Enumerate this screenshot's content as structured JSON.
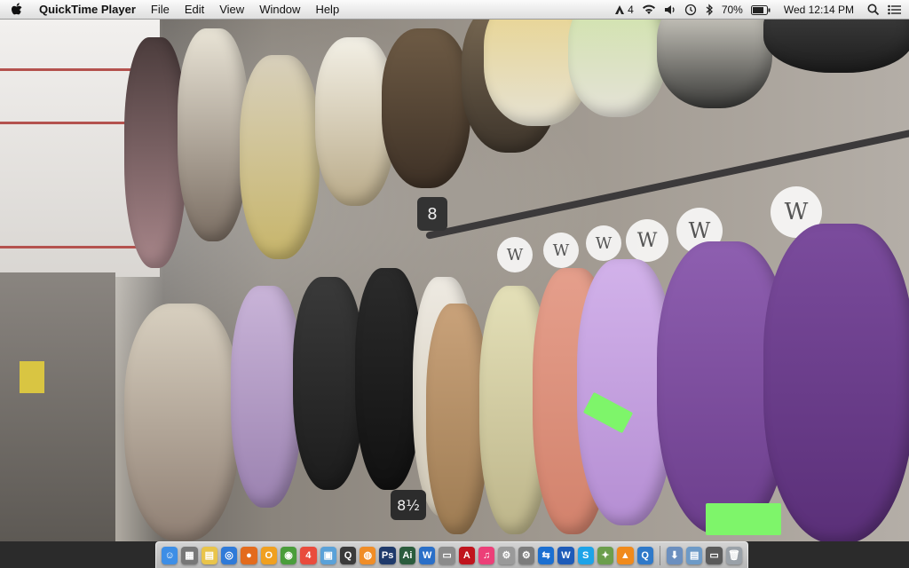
{
  "menubar": {
    "app_name": "QuickTime Player",
    "menus": [
      "File",
      "Edit",
      "View",
      "Window",
      "Help"
    ],
    "status": {
      "adobe_count": "4",
      "battery": "70%",
      "clock": "Wed 12:14 PM"
    }
  },
  "video": {
    "tags": [
      "W",
      "W",
      "W",
      "W",
      "W",
      "W",
      "W"
    ],
    "size_tags": [
      "8",
      "8½"
    ]
  },
  "dock": {
    "icons": [
      {
        "name": "finder-icon",
        "color": "#3d8ee6",
        "glyph": "☺"
      },
      {
        "name": "calculator-icon",
        "color": "#777777",
        "glyph": "▦"
      },
      {
        "name": "folder-icon",
        "color": "#e9c44a",
        "glyph": "▤"
      },
      {
        "name": "safari-icon",
        "color": "#2f7ad8",
        "glyph": "◎"
      },
      {
        "name": "firefox-icon",
        "color": "#e36b1c",
        "glyph": "●"
      },
      {
        "name": "itunes-circle-icon",
        "color": "#f0a020",
        "glyph": "O"
      },
      {
        "name": "chrome-icon",
        "color": "#4a9d3b",
        "glyph": "◉"
      },
      {
        "name": "calendar-icon",
        "color": "#e94b3c",
        "glyph": "4"
      },
      {
        "name": "preview-icon",
        "color": "#5aa1d8",
        "glyph": "▣"
      },
      {
        "name": "quicktime-icon",
        "color": "#3a3a3a",
        "glyph": "Q"
      },
      {
        "name": "app-orange-icon",
        "color": "#f08d27",
        "glyph": "◍"
      },
      {
        "name": "photoshop-icon",
        "color": "#1f3a6b",
        "glyph": "Ps"
      },
      {
        "name": "illustrator-icon",
        "color": "#2b5c3d",
        "glyph": "Ai"
      },
      {
        "name": "word-icon",
        "color": "#2a6fc8",
        "glyph": "W"
      },
      {
        "name": "app-gray-icon",
        "color": "#8b8b8b",
        "glyph": "▭"
      },
      {
        "name": "acrobat-icon",
        "color": "#c0141d",
        "glyph": "A"
      },
      {
        "name": "music-icon",
        "color": "#ec3f78",
        "glyph": "♫"
      },
      {
        "name": "utility-icon",
        "color": "#9a9a9a",
        "glyph": "⚙"
      },
      {
        "name": "settings-icon",
        "color": "#7c7c7c",
        "glyph": "⚙"
      },
      {
        "name": "teamviewer-icon",
        "color": "#1b6fd1",
        "glyph": "⇆"
      },
      {
        "name": "word-blue-icon",
        "color": "#1e5bb8",
        "glyph": "W"
      },
      {
        "name": "skype-icon",
        "color": "#1da3e8",
        "glyph": "S"
      },
      {
        "name": "app-leaf-icon",
        "color": "#6b9e4c",
        "glyph": "✦"
      },
      {
        "name": "vlc-icon",
        "color": "#f08a1b",
        "glyph": "▲"
      },
      {
        "name": "quicktime-q-icon",
        "color": "#2f79c9",
        "glyph": "Q"
      }
    ],
    "trailing_icons": [
      {
        "name": "downloads-icon",
        "color": "#6b8fbf",
        "glyph": "⬇"
      },
      {
        "name": "documents-icon",
        "color": "#6d9ac7",
        "glyph": "▤"
      },
      {
        "name": "window-icon",
        "color": "#5a5a5a",
        "glyph": "▭"
      },
      {
        "name": "trash-icon",
        "color": "#9aa1a8",
        "glyph": "🗑"
      }
    ]
  }
}
